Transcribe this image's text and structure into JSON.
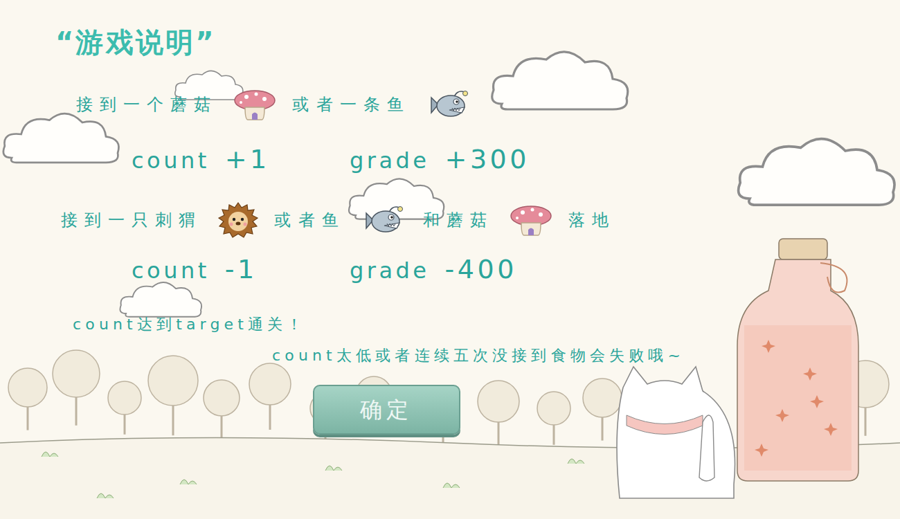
{
  "title": "“游戏说明”",
  "sections": [
    {
      "condition": [
        {
          "kind": "text",
          "text": "接到一个蘑菇"
        },
        {
          "kind": "mushroom"
        },
        {
          "kind": "text",
          "text": "或者一条鱼"
        },
        {
          "kind": "fish"
        }
      ],
      "effects": [
        {
          "label": "count",
          "value": "+1"
        },
        {
          "label": "grade",
          "value": "+300"
        }
      ]
    },
    {
      "condition": [
        {
          "kind": "text",
          "text": "接到一只刺猬"
        },
        {
          "kind": "hedgehog"
        },
        {
          "kind": "text",
          "text": "或者鱼"
        },
        {
          "kind": "fish"
        },
        {
          "kind": "text",
          "text": "和蘑菇"
        },
        {
          "kind": "mushroom"
        },
        {
          "kind": "text",
          "text": "落地"
        }
      ],
      "effects": [
        {
          "label": "count",
          "value": "-1"
        },
        {
          "label": "grade",
          "value": "-400"
        }
      ]
    }
  ],
  "win_text": "count达到target通关！",
  "lose_text": "count太低或者连续五次没接到食物会失败哦~",
  "button": "确定"
}
